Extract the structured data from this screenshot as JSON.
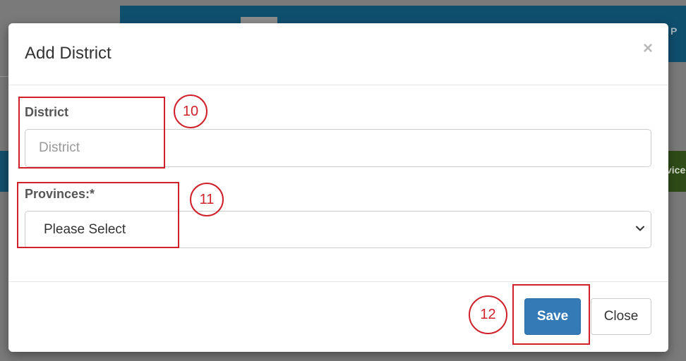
{
  "background": {
    "header_partial_text": "P",
    "side_button_partial_text": "vice"
  },
  "modal": {
    "title": "Add District",
    "close_symbol": "×",
    "fields": {
      "district": {
        "label": "District",
        "placeholder": "District",
        "value": ""
      },
      "province": {
        "label": "Provinces:*",
        "selected": "Please Select"
      }
    },
    "buttons": {
      "save": "Save",
      "close": "Close"
    }
  },
  "annotations": [
    {
      "number": "10",
      "target": "district-field"
    },
    {
      "number": "11",
      "target": "province-field"
    },
    {
      "number": "12",
      "target": "save-button"
    }
  ],
  "colors": {
    "primary": "#337ab7",
    "annotation": "#d0202a",
    "header_bg": "#0f4f6e",
    "overlay": "#7a7a7a"
  }
}
